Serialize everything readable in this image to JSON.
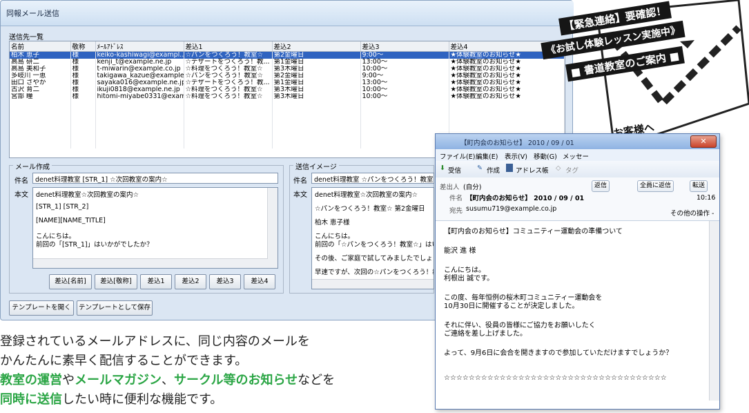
{
  "window": {
    "title": "同報メール送信",
    "list_label": "送信先一覧",
    "columns": [
      "名前",
      "敬称",
      "ﾒｰﾙｱﾄﾞﾚｽ",
      "差込1",
      "差込2",
      "差込3",
      "差込4"
    ],
    "rows": [
      [
        "柏木 恵子",
        "様",
        "keiko-kashiwagi@exampl...",
        "☆パンをつくろう！教室☆",
        "第2金曜日",
        "9:00～",
        "★体験教室のお知らせ★"
      ],
      [
        "高島 研二",
        "様",
        "kenji_t@example.ne.jp",
        "☆デザートをつくろう！教...",
        "第1金曜日",
        "13:00～",
        "★体験教室のお知らせ★"
      ],
      [
        "高島 美和子",
        "様",
        "t-miwarin@example.co.jp",
        "☆料理をつくろう！教室☆",
        "第3木曜日",
        "10:00～",
        "★体験教室のお知らせ★"
      ],
      [
        "多岐川 一恵",
        "様",
        "takigawa_kazue@example...",
        "☆パンをつくろう！教室☆",
        "第2金曜日",
        "9:00～",
        "★体験教室のお知らせ★"
      ],
      [
        "田口 さやか",
        "様",
        "sayaka016@example.ne.jp",
        "☆デザートをつくろう！教...",
        "第1金曜日",
        "13:00～",
        "★体験教室のお知らせ★"
      ],
      [
        "古沢 育二",
        "様",
        "ikuji0818@example.ne.jp",
        "☆料理をつくろう！教室☆",
        "第3木曜日",
        "10:00～",
        "★体験教室のお知らせ★"
      ],
      [
        "宮部 瞳",
        "様",
        "hitomi-miyabe0331@exam...",
        "☆料理をつくろう！教室☆",
        "第3木曜日",
        "10:00～",
        "★体験教室のお知らせ★"
      ]
    ],
    "compose": {
      "legend": "メール作成",
      "subject_label": "件名",
      "subject_value": "denet料理教室 [STR_1] ☆次回教室の案内☆",
      "body_label": "本文",
      "body_lines": [
        "denet料理教室☆次回教室の案内☆",
        "[STR_1] [STR_2]",
        "[NAME][NAME_TITLE]",
        "こんにちは。",
        "前回の「[STR_1]」はいかがでしたか？"
      ],
      "buttons": [
        "差込[名前]",
        "差込[敬称]",
        "差込1",
        "差込2",
        "差込3",
        "差込4"
      ]
    },
    "preview": {
      "legend": "送信イメージ",
      "subject_label": "件名",
      "subject_value": "denet料理教室 ☆パンをつくろう！教室☆",
      "body_label": "本文",
      "body_lines": [
        "denet料理教室☆次回教室の案内☆",
        "☆パンをつくろう！教室☆ 第2金曜日",
        "柏木 恵子様",
        "こんにちは。",
        "前回の「☆パンをつくろう！教室☆」はいか",
        "その後、ご家庭で試してみましたでしょう",
        "早速ですが、次回の☆パンをつくろう！教"
      ]
    },
    "footer_buttons": [
      "テンプレートを開く",
      "テンプレートとして保存"
    ]
  },
  "promo": {
    "line1": "登録されているメールアドレスに、同じ内容のメールを",
    "line2": "かんたんに素早く配信することができます。",
    "line3_parts": [
      {
        "text": "教室の運営",
        "green": true
      },
      {
        "text": "や",
        "green": false
      },
      {
        "text": "メールマガジン",
        "green": true
      },
      {
        "text": "、",
        "green": false
      },
      {
        "text": "サークル等のお知らせ",
        "green": true
      },
      {
        "text": "などを",
        "green": false
      }
    ],
    "line4_parts": [
      {
        "text": "同時に送信",
        "green": true
      },
      {
        "text": "したい時に便利な機能です。",
        "green": false
      }
    ]
  },
  "envelope": {
    "line1": "【緊急連絡】要確認！",
    "line2": "《お試し体験レッスン実施中》",
    "line3": "■ 書道教室のご案内 ■",
    "label": "お客様へ"
  },
  "mail": {
    "title": "【町内会のお知らせ】 2010 / 09 / 01",
    "menu": [
      "ファイル(E)",
      "編集(E)",
      "表示(V)",
      "移動(G)",
      "メッセー"
    ],
    "toolbar": [
      "受信",
      "作成",
      "アドレス帳",
      "タグ"
    ],
    "from_label": "差出人",
    "from_value": "(自分)",
    "subject_label": "件名",
    "subject_value": "【町内会のお知らせ】 2010 / 09 / 01",
    "to_label": "宛先",
    "to_value": "susumu719@example.co.jp",
    "time": "10:16",
    "reply_buttons": [
      "返信",
      "全員に返信",
      "転送"
    ],
    "other_actions": "その他の操作 -",
    "body_lines": [
      "【町内会のお知らせ】コミュニティー運動会の準備ついて",
      "",
      "能沢 進  様",
      "",
      "こんにちは。",
      "利根出  誠です。",
      "",
      "この度、毎年恒例の桜木町コミュニティー運動会を",
      "10月30日に開催することが決定しました。",
      "",
      "それに伴い、役員の皆様にご協力をお願いしたく",
      "ご連絡を差し上げました。",
      "",
      "よって、9月6日に会合を開きますので参加していただけますでしょうか？",
      "",
      "",
      "☆☆☆☆☆☆☆☆☆☆☆☆☆☆☆☆☆☆☆☆☆☆☆☆☆☆☆☆☆☆☆☆☆☆☆☆"
    ]
  }
}
